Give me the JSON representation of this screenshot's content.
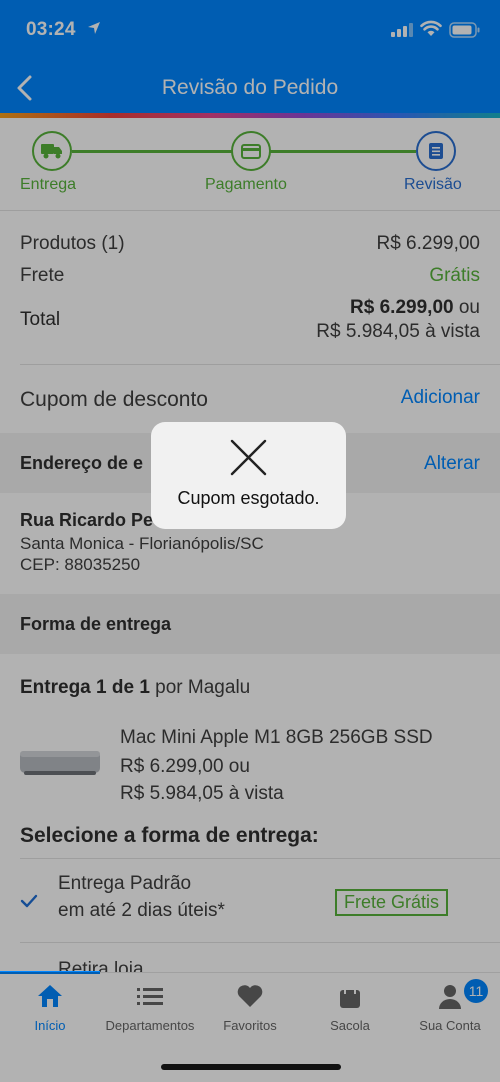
{
  "status_bar": {
    "time": "03:24"
  },
  "header": {
    "title": "Revisão do Pedido"
  },
  "steps": [
    {
      "label": "Entrega",
      "state": "done"
    },
    {
      "label": "Pagamento",
      "state": "done"
    },
    {
      "label": "Revisão",
      "state": "current"
    }
  ],
  "summary": {
    "products_label": "Produtos (1)",
    "products_value": "R$ 6.299,00",
    "shipping_label": "Frete",
    "shipping_value": "Grátis",
    "total_label": "Total",
    "total_value": "R$ 6.299,00",
    "total_or": "ou",
    "total_cash": "R$ 5.984,05 à vista"
  },
  "coupon": {
    "label": "Cupom de desconto",
    "action": "Adicionar"
  },
  "address": {
    "section_title": "Endereço de e",
    "action": "Alterar",
    "street": "Rua Ricardo Pe",
    "street_hidden": "",
    "city": "Santa Monica - Florianópolis/SC",
    "cep": "CEP: 88035250"
  },
  "delivery": {
    "section_title": "Forma de entrega",
    "shipment_prefix": "Entrega 1 de 1",
    "shipment_seller": "por Magalu",
    "product_name": "Mac Mini Apple M1 8GB 256GB SSD",
    "product_price": "R$ 6.299,00 ou",
    "product_cash": "R$ 5.984,05 à vista",
    "select_title": "Selecione a forma de entrega:",
    "option1_title": "Entrega Padrão",
    "option1_sub": "em até 2 dias úteis*",
    "option1_badge": "Frete Grátis",
    "option2_title": "Retira loja"
  },
  "toast": {
    "message": "Cupom esgotado."
  },
  "tabbar": {
    "items": [
      {
        "label": "Início",
        "icon": "home-icon",
        "active": true
      },
      {
        "label": "Departamentos",
        "icon": "list-icon"
      },
      {
        "label": "Favoritos",
        "icon": "heart-icon"
      },
      {
        "label": "Sacola",
        "icon": "bag-icon"
      },
      {
        "label": "Sua Conta",
        "icon": "user-icon",
        "badge": "11"
      }
    ]
  },
  "colors": {
    "brand_blue": "#0086ff",
    "green": "#58b33b",
    "link_blue": "#0086ff"
  }
}
